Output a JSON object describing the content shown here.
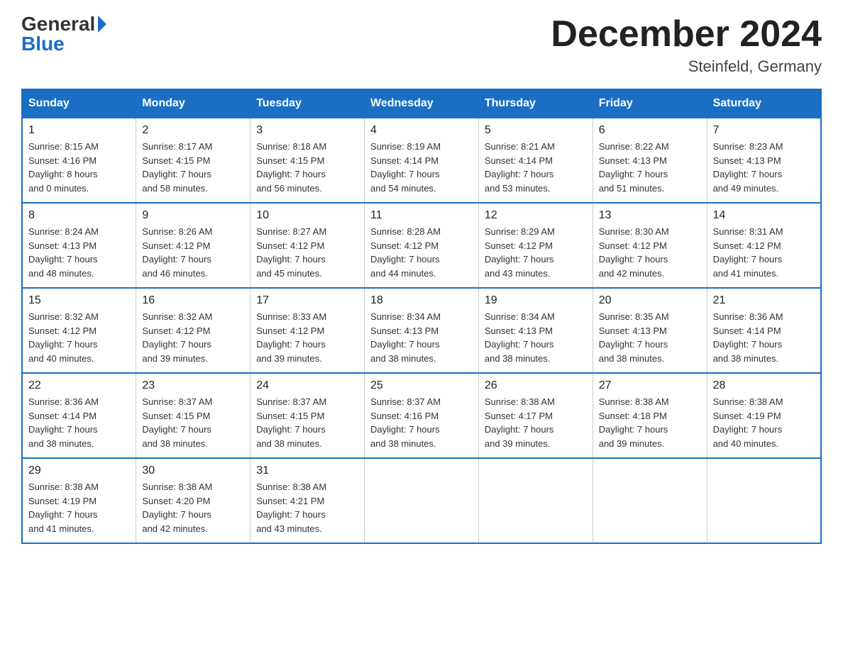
{
  "header": {
    "logo_general": "General",
    "logo_blue": "Blue",
    "month_title": "December 2024",
    "location": "Steinfeld, Germany"
  },
  "days_of_week": [
    "Sunday",
    "Monday",
    "Tuesday",
    "Wednesday",
    "Thursday",
    "Friday",
    "Saturday"
  ],
  "weeks": [
    [
      {
        "day": "1",
        "sunrise": "8:15 AM",
        "sunset": "4:16 PM",
        "daylight": "8 hours and 0 minutes."
      },
      {
        "day": "2",
        "sunrise": "8:17 AM",
        "sunset": "4:15 PM",
        "daylight": "7 hours and 58 minutes."
      },
      {
        "day": "3",
        "sunrise": "8:18 AM",
        "sunset": "4:15 PM",
        "daylight": "7 hours and 56 minutes."
      },
      {
        "day": "4",
        "sunrise": "8:19 AM",
        "sunset": "4:14 PM",
        "daylight": "7 hours and 54 minutes."
      },
      {
        "day": "5",
        "sunrise": "8:21 AM",
        "sunset": "4:14 PM",
        "daylight": "7 hours and 53 minutes."
      },
      {
        "day": "6",
        "sunrise": "8:22 AM",
        "sunset": "4:13 PM",
        "daylight": "7 hours and 51 minutes."
      },
      {
        "day": "7",
        "sunrise": "8:23 AM",
        "sunset": "4:13 PM",
        "daylight": "7 hours and 49 minutes."
      }
    ],
    [
      {
        "day": "8",
        "sunrise": "8:24 AM",
        "sunset": "4:13 PM",
        "daylight": "7 hours and 48 minutes."
      },
      {
        "day": "9",
        "sunrise": "8:26 AM",
        "sunset": "4:12 PM",
        "daylight": "7 hours and 46 minutes."
      },
      {
        "day": "10",
        "sunrise": "8:27 AM",
        "sunset": "4:12 PM",
        "daylight": "7 hours and 45 minutes."
      },
      {
        "day": "11",
        "sunrise": "8:28 AM",
        "sunset": "4:12 PM",
        "daylight": "7 hours and 44 minutes."
      },
      {
        "day": "12",
        "sunrise": "8:29 AM",
        "sunset": "4:12 PM",
        "daylight": "7 hours and 43 minutes."
      },
      {
        "day": "13",
        "sunrise": "8:30 AM",
        "sunset": "4:12 PM",
        "daylight": "7 hours and 42 minutes."
      },
      {
        "day": "14",
        "sunrise": "8:31 AM",
        "sunset": "4:12 PM",
        "daylight": "7 hours and 41 minutes."
      }
    ],
    [
      {
        "day": "15",
        "sunrise": "8:32 AM",
        "sunset": "4:12 PM",
        "daylight": "7 hours and 40 minutes."
      },
      {
        "day": "16",
        "sunrise": "8:32 AM",
        "sunset": "4:12 PM",
        "daylight": "7 hours and 39 minutes."
      },
      {
        "day": "17",
        "sunrise": "8:33 AM",
        "sunset": "4:12 PM",
        "daylight": "7 hours and 39 minutes."
      },
      {
        "day": "18",
        "sunrise": "8:34 AM",
        "sunset": "4:13 PM",
        "daylight": "7 hours and 38 minutes."
      },
      {
        "day": "19",
        "sunrise": "8:34 AM",
        "sunset": "4:13 PM",
        "daylight": "7 hours and 38 minutes."
      },
      {
        "day": "20",
        "sunrise": "8:35 AM",
        "sunset": "4:13 PM",
        "daylight": "7 hours and 38 minutes."
      },
      {
        "day": "21",
        "sunrise": "8:36 AM",
        "sunset": "4:14 PM",
        "daylight": "7 hours and 38 minutes."
      }
    ],
    [
      {
        "day": "22",
        "sunrise": "8:36 AM",
        "sunset": "4:14 PM",
        "daylight": "7 hours and 38 minutes."
      },
      {
        "day": "23",
        "sunrise": "8:37 AM",
        "sunset": "4:15 PM",
        "daylight": "7 hours and 38 minutes."
      },
      {
        "day": "24",
        "sunrise": "8:37 AM",
        "sunset": "4:15 PM",
        "daylight": "7 hours and 38 minutes."
      },
      {
        "day": "25",
        "sunrise": "8:37 AM",
        "sunset": "4:16 PM",
        "daylight": "7 hours and 38 minutes."
      },
      {
        "day": "26",
        "sunrise": "8:38 AM",
        "sunset": "4:17 PM",
        "daylight": "7 hours and 39 minutes."
      },
      {
        "day": "27",
        "sunrise": "8:38 AM",
        "sunset": "4:18 PM",
        "daylight": "7 hours and 39 minutes."
      },
      {
        "day": "28",
        "sunrise": "8:38 AM",
        "sunset": "4:19 PM",
        "daylight": "7 hours and 40 minutes."
      }
    ],
    [
      {
        "day": "29",
        "sunrise": "8:38 AM",
        "sunset": "4:19 PM",
        "daylight": "7 hours and 41 minutes."
      },
      {
        "day": "30",
        "sunrise": "8:38 AM",
        "sunset": "4:20 PM",
        "daylight": "7 hours and 42 minutes."
      },
      {
        "day": "31",
        "sunrise": "8:38 AM",
        "sunset": "4:21 PM",
        "daylight": "7 hours and 43 minutes."
      },
      null,
      null,
      null,
      null
    ]
  ],
  "labels": {
    "sunrise": "Sunrise:",
    "sunset": "Sunset:",
    "daylight": "Daylight:"
  }
}
